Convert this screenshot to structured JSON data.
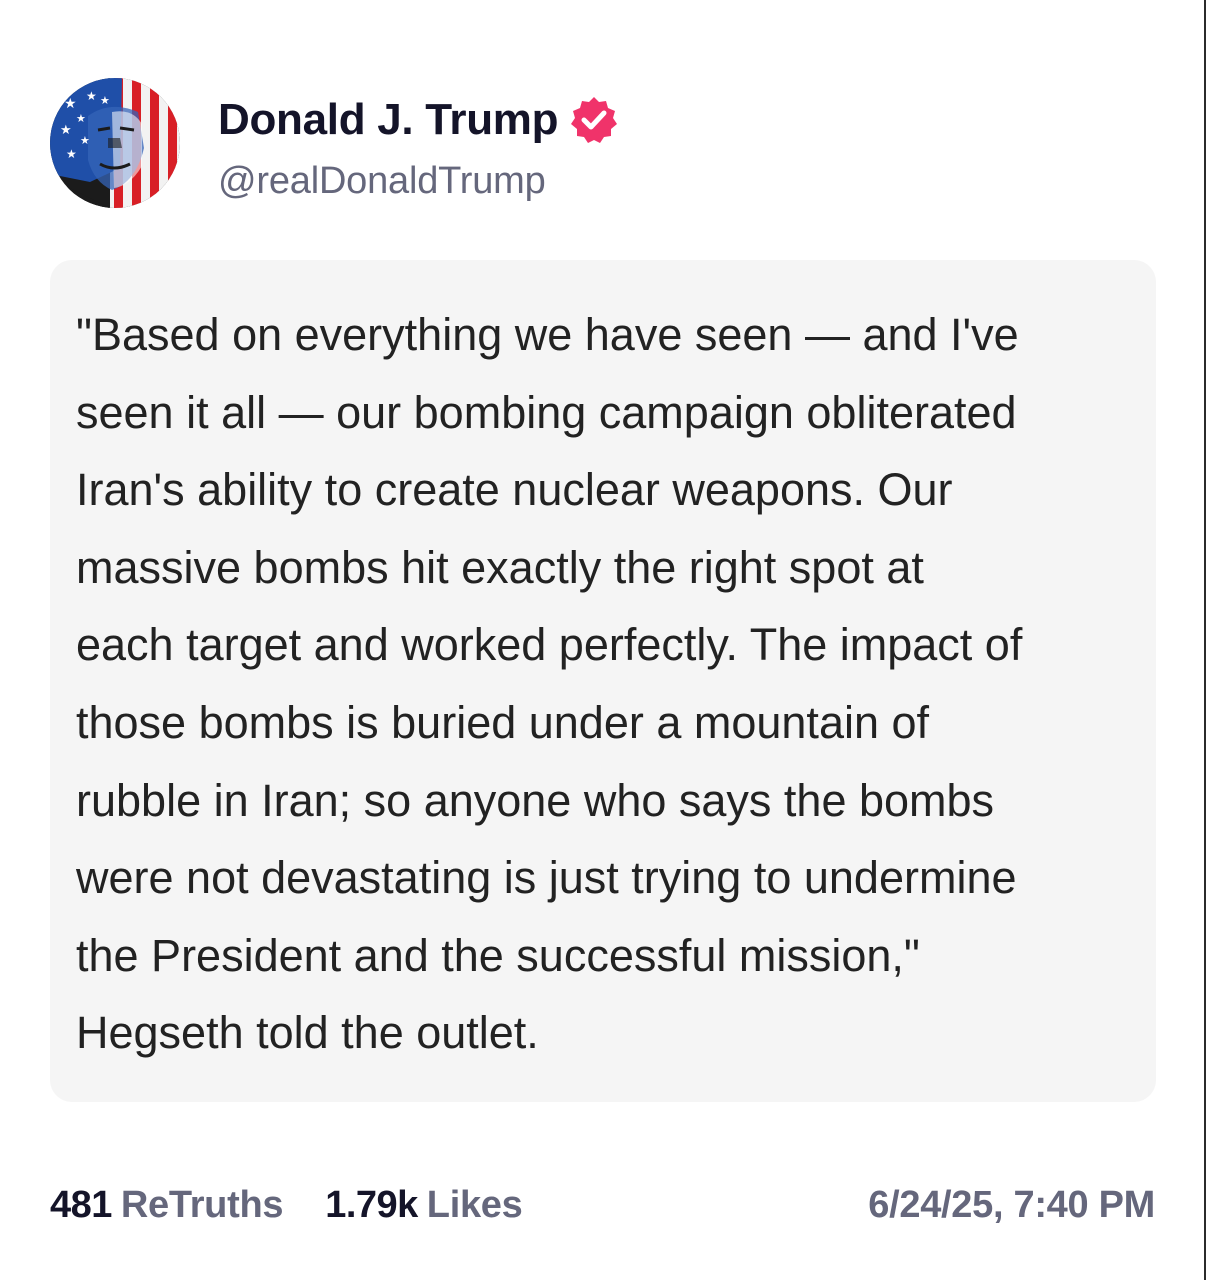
{
  "post": {
    "author": {
      "display_name": "Donald J. Trump",
      "handle": "@realDonaldTrump",
      "verified": true,
      "avatar_icon": "avatar-flag-portrait-icon",
      "verified_icon": "verified-badge-icon",
      "verified_color": "#f0336a"
    },
    "quote_lines": [
      "\"Based on everything we have seen — and I've",
      "seen it all — our bombing campaign obliterated",
      "Iran's ability to create nuclear weapons. Our",
      "massive bombs hit exactly the right spot at",
      "each target and worked perfectly. The impact of",
      "those bombs is buried under a mountain of",
      "rubble in Iran; so anyone who says the bombs",
      "were not devastating is just trying to undermine",
      "the President and the successful mission,\"",
      "Hegseth told the outlet."
    ],
    "stats": {
      "retruths_count": "481",
      "retruths_label": "ReTruths",
      "likes_count": "1.79k",
      "likes_label": "Likes"
    },
    "timestamp": "6/24/25, 7:40 PM"
  },
  "colors": {
    "name_text": "#141429",
    "muted_text": "#65677c",
    "card_background": "#f5f5f5",
    "body_text": "#222222"
  }
}
